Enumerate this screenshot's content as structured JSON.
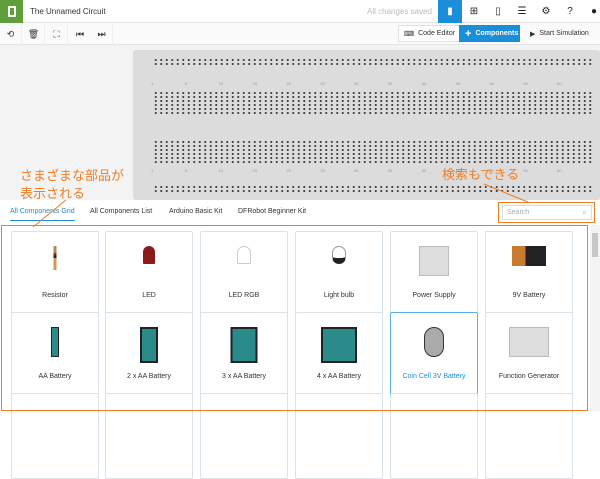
{
  "header": {
    "title": "The Unnamed Circuit",
    "status": "All changes saved",
    "icons": [
      "circuit-view-icon",
      "schematic-icon",
      "component-list-icon",
      "list-icon",
      "gear-icon",
      "help-icon",
      "user-avatar-icon"
    ]
  },
  "toolbar": {
    "code_editor": "Code Editor",
    "components": "Components",
    "start_simulation": "Start Simulation"
  },
  "breadboard": {
    "column_numbers": [
      "1",
      "5",
      "10",
      "15",
      "20",
      "25",
      "30",
      "35",
      "40",
      "45",
      "50",
      "55",
      "60"
    ]
  },
  "tabs": [
    "All Components Grid",
    "All Components List",
    "Arduino Basic Kit",
    "DFRobot Beginner Kit"
  ],
  "search": {
    "placeholder": "Search"
  },
  "annotations": {
    "left_line1": "さまざまな部品が",
    "left_line2": "表示される",
    "right": "検索もできる"
  },
  "components": [
    "Resistor",
    "LED",
    "LED RGB",
    "Light bulb",
    "Power Supply",
    "9V Battery",
    "AA Battery",
    "2 x AA Battery",
    "3 x AA Battery",
    "4 x AA Battery",
    "Coin Cell 3V Battery",
    "Function Generator"
  ],
  "colors": {
    "accent": "#1a8ed8",
    "annotation": "#f07d22",
    "logo": "#5f9e3a"
  }
}
